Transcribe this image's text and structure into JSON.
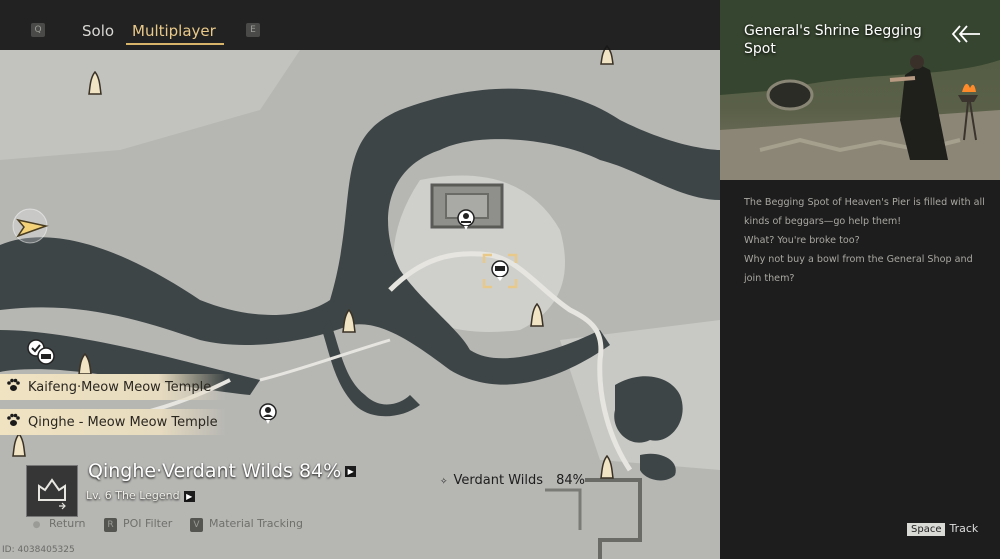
{
  "topbar": {
    "left_key": "Q",
    "tabs": [
      {
        "label": "Solo"
      },
      {
        "label": "Multiplayer"
      }
    ],
    "right_key": "E"
  },
  "map": {
    "tracked_markers": [
      {
        "label": "Kaifeng·Meow Meow Temple"
      },
      {
        "label": "Qinghe - Meow Meow Temple"
      }
    ],
    "region": {
      "title": "Qinghe·Verdant Wilds 84%",
      "level": "Lv. 6 The Legend"
    },
    "area_label": {
      "name": "Verdant Wilds",
      "percent": "84%"
    },
    "hints": [
      {
        "key": "",
        "label": "Return"
      },
      {
        "key": "R",
        "label": "POI Filter"
      },
      {
        "key": "V",
        "label": "Material Tracking"
      }
    ],
    "uid": "ID: 4038405325"
  },
  "panel": {
    "title": "General's Shrine Begging Spot",
    "description": [
      "The Begging Spot of Heaven's Pier is filled with all",
      "kinds of beggars—go help them!",
      "What? You're broke too?",
      "Why not buy a bowl from the General Shop and",
      "join them?"
    ],
    "track_key": "Space",
    "track_label": "Track"
  },
  "colors": {
    "accent": "#d7b46a",
    "river": "#3b4243",
    "land": "#b9b9b6",
    "panel_bg": "#1d1d1d"
  }
}
